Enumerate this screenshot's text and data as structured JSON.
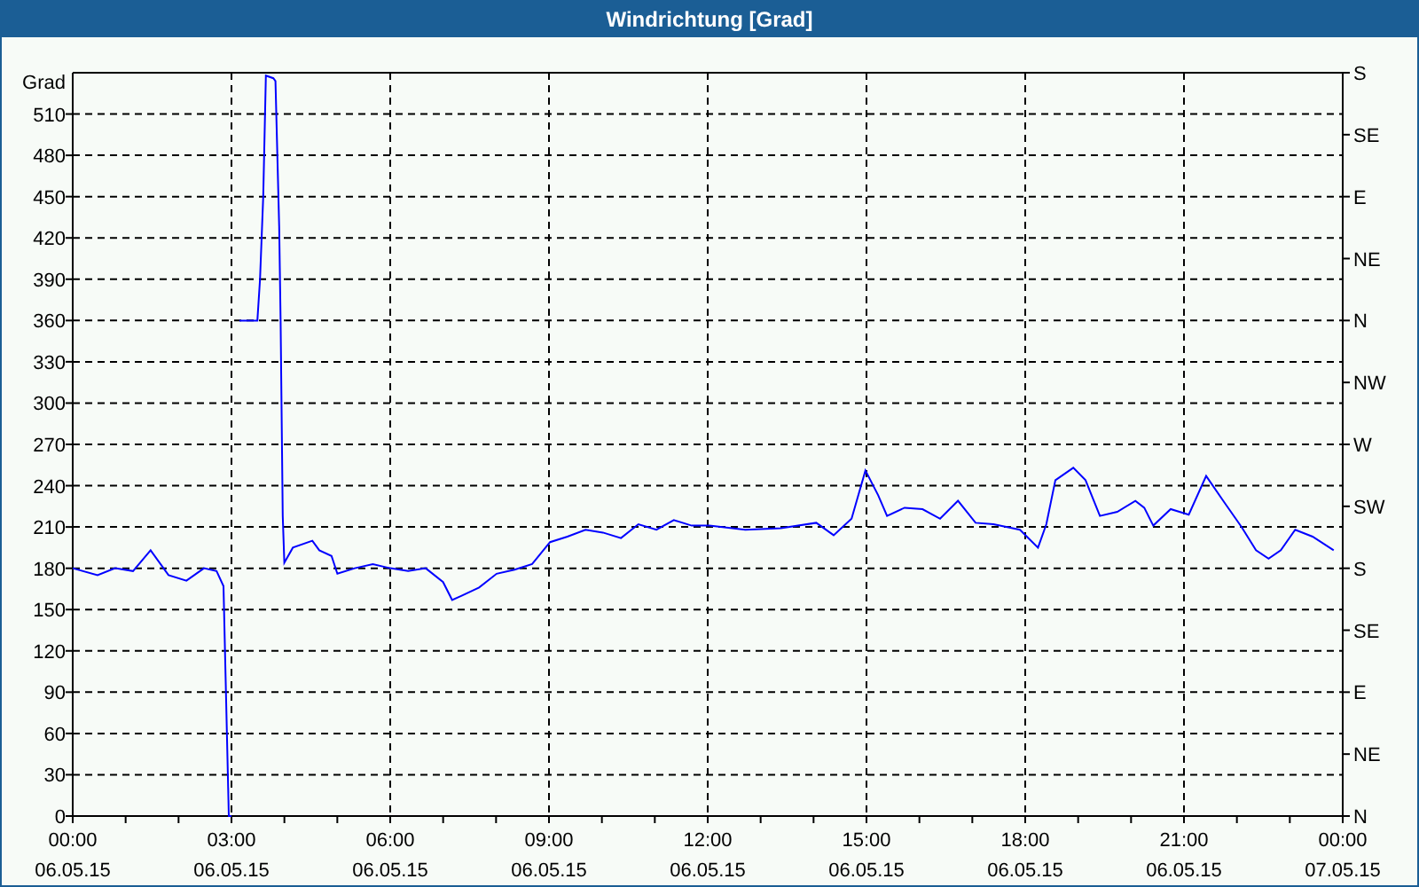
{
  "window": {
    "title": "Windrichtung [Grad]"
  },
  "chart": {
    "chart_data": {
      "type": "line",
      "ylabel": "Grad",
      "x": [
        0,
        0.47,
        0.8,
        1.14,
        1.47,
        1.81,
        2.15,
        2.48,
        2.72,
        2.85,
        2.95,
        3.0,
        3.15,
        3.49,
        3.54,
        3.6,
        3.65,
        3.79,
        3.83,
        3.9,
        3.93,
        3.97,
        4.0,
        4.16,
        4.53,
        4.66,
        4.89,
        5.0,
        5.33,
        5.67,
        6.0,
        6.34,
        6.67,
        7.0,
        7.17,
        7.34,
        7.68,
        8.01,
        8.35,
        8.68,
        9.02,
        9.35,
        9.69,
        10.02,
        10.36,
        10.69,
        11.03,
        11.36,
        11.7,
        12.03,
        12.71,
        13.38,
        14.05,
        14.38,
        14.72,
        14.98,
        15.22,
        15.39,
        15.72,
        16.06,
        16.39,
        16.73,
        17.06,
        17.4,
        17.9,
        18.24,
        18.4,
        18.57,
        18.91,
        19.14,
        19.41,
        19.74,
        20.08,
        20.25,
        20.42,
        20.75,
        21.09,
        21.42,
        21.76,
        22.09,
        22.36,
        22.6,
        22.83,
        23.1,
        23.43,
        23.83
      ],
      "grid": true,
      "series": [
        {
          "color": "#0000ff",
          "values": [
            180,
            175,
            180,
            178,
            193,
            175,
            171,
            180,
            178,
            167,
            0,
            null,
            360,
            360,
            390,
            450,
            538,
            536,
            534,
            428,
            360,
            218,
            184,
            195,
            200,
            193,
            189,
            176,
            180,
            183,
            180,
            178,
            180,
            170,
            157,
            160,
            166,
            176,
            179,
            183,
            199,
            203,
            208,
            206,
            202,
            212,
            208,
            215,
            211,
            211,
            208,
            209,
            213,
            204,
            216,
            251,
            233,
            218,
            224,
            223,
            216,
            229,
            213,
            212,
            208,
            195,
            212,
            244,
            253,
            244,
            218,
            221,
            229,
            224,
            211,
            223,
            219,
            247,
            228,
            210,
            193,
            187,
            193,
            208,
            203,
            193
          ]
        }
      ],
      "xlim": [
        0,
        24
      ],
      "ylim": [
        0,
        540
      ],
      "xticks": [
        {
          "value": 0,
          "label": "00:00"
        },
        {
          "value": 3,
          "label": "03:00"
        },
        {
          "value": 6,
          "label": "06:00"
        },
        {
          "value": 9,
          "label": "09:00"
        },
        {
          "value": 12,
          "label": "12:00"
        },
        {
          "value": 15,
          "label": "15:00"
        },
        {
          "value": 18,
          "label": "18:00"
        },
        {
          "value": 21,
          "label": "21:00"
        },
        {
          "value": 24,
          "label": "00:00"
        }
      ],
      "yticks": [
        0,
        30,
        60,
        90,
        120,
        150,
        180,
        210,
        240,
        270,
        300,
        330,
        360,
        390,
        420,
        450,
        480,
        510
      ]
    },
    "x_tick_dates": [
      "06.05.15",
      "06.05.15",
      "06.05.15",
      "06.05.15",
      "06.05.15",
      "06.05.15",
      "06.05.15",
      "06.05.15",
      "07.05.15"
    ],
    "right_axis_labels": [
      "S",
      "SE",
      "E",
      "NE",
      "N",
      "NW",
      "W",
      "SW",
      "S",
      "SE",
      "E",
      "NE",
      "N"
    ]
  }
}
